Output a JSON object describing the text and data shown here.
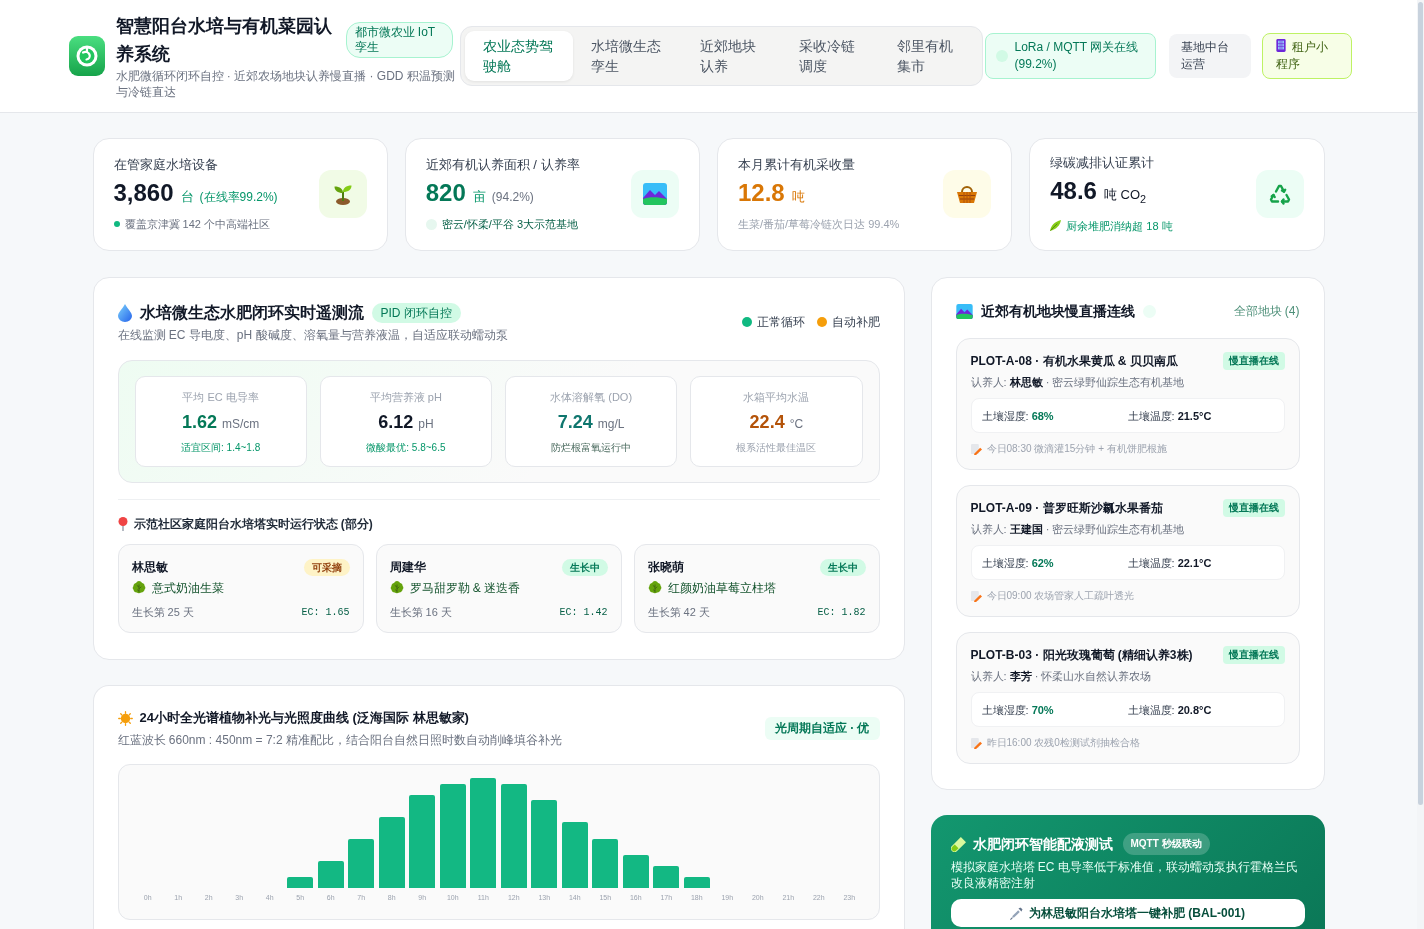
{
  "header": {
    "title": "智慧阳台水培与有机菜园认养系统",
    "badge": "都市微农业 IoT 孪生",
    "subtitle": "水肥微循环闭环自控 · 近郊农场地块认养慢直播 · GDD 积温预测与冷链直达",
    "tabs": [
      {
        "label": "农业态势驾驶舱",
        "selected": true
      },
      {
        "label": "水培微生态孪生",
        "selected": false
      },
      {
        "label": "近郊地块认养",
        "selected": false
      },
      {
        "label": "采收冷链调度",
        "selected": false
      },
      {
        "label": "邻里有机集市",
        "selected": false
      }
    ],
    "gateway": "LoRa / MQTT 网关在线 (99.2%)",
    "actions": [
      {
        "label": "基地中台运营",
        "kind": "plain"
      },
      {
        "label": "租户小程序",
        "kind": "app"
      }
    ]
  },
  "kpis": [
    {
      "label": "在管家庭水培设备",
      "value": "3,860",
      "unit": "台",
      "extra": "(在线率99.2%)",
      "note": "覆盖京津冀 142 个中高端社区",
      "color": "#111827"
    },
    {
      "label": "近郊有机认养面积 / 认养率",
      "value": "820",
      "unit": "亩",
      "extra": "(94.2%)",
      "note": "密云/怀柔/平谷 3大示范基地",
      "color": "#047857"
    },
    {
      "label": "本月累计有机采收量",
      "value": "12.8",
      "unit": "吨",
      "note": "生菜/番茄/草莓冷链次日达 99.4%",
      "color": "#d97706"
    },
    {
      "label": "绿碳减排认证累计",
      "value": "48.6",
      "unit": "吨 CO$_{2}$",
      "note": "厨余堆肥消纳超 18 吨",
      "color": "#111827"
    }
  ],
  "telemetry": {
    "title": "水培微生态水肥闭环实时遥测流",
    "badge": "PID 闭环自控",
    "subtitle": "在线监测 EC 导电度、pH 酸碱度、溶氧量与营养液温，自适应联动蠕动泵",
    "legend": [
      {
        "label": "正常循环",
        "color": "#10b981"
      },
      {
        "label": "自动补肥",
        "color": "#f59e0b"
      }
    ],
    "metrics": [
      {
        "label": "平均 EC 电导率",
        "value": "1.62",
        "unit": "mS/cm",
        "note": "适宜区间: 1.4~1.8",
        "color": "#047857"
      },
      {
        "label": "平均营养液 pH",
        "value": "6.12",
        "unit": "pH",
        "note": "微酸最优: 5.8~6.5",
        "color": "#111827"
      },
      {
        "label": "水体溶解氧 (DO)",
        "value": "7.24",
        "unit": "mg/L",
        "note": "防烂根富氧运行中",
        "color": "#0f766e"
      },
      {
        "label": "水箱平均水温",
        "value": "22.4",
        "unit": "°C",
        "note": "根系活性最佳温区",
        "color": "#b45309"
      }
    ],
    "towers_title": "示范社区家庭阳台水培塔实时运行状态 (部分)",
    "towers": [
      {
        "owner": "林思敏",
        "status": "可采摘",
        "ready": true,
        "plant": "意式奶油生菜",
        "days": "生长第 25 天",
        "ec": "EC: 1.65"
      },
      {
        "owner": "周建华",
        "status": "生长中",
        "ready": false,
        "plant": "罗马甜罗勒 & 迷迭香",
        "days": "生长第 16 天",
        "ec": "EC: 1.42"
      },
      {
        "owner": "张晓萌",
        "status": "生长中",
        "ready": false,
        "plant": "红颜奶油草莓立柱塔",
        "days": "生长第 42 天",
        "ec": "EC: 1.82"
      }
    ]
  },
  "lighting": {
    "title": "24小时全光谱植物补光与光照度曲线 (泛海国际 林思敏家)",
    "subtitle": "红蓝波长 660nm : 450nm = 7:2 精准配比，结合阳台自然日照时数自动削峰填谷补光",
    "badge": "光周期自适应 · 优",
    "hour_labels": [
      "0h",
      "1h",
      "2h",
      "3h",
      "4h",
      "5h",
      "6h",
      "7h",
      "8h",
      "9h",
      "10h",
      "11h",
      "12h",
      "13h",
      "14h",
      "15h",
      "16h",
      "17h",
      "18h",
      "19h",
      "20h",
      "21h",
      "22h",
      "23h"
    ]
  },
  "plots": {
    "title": "近郊有机地块慢直播连线",
    "link": "全部地块 (4)",
    "items": [
      {
        "title": "PLOT-A-08 · 有机水果黄瓜 & 贝贝南瓜",
        "status": "慢直播在线",
        "adopter": "认养人: **林思敏** · 密云绿野仙踪生态有机基地",
        "humidity": "土壤湿度: **68%**",
        "temperature": "土壤温度: **21.5°C**",
        "log": "今日08:30 微滴灌15分钟 + 有机饼肥根施"
      },
      {
        "title": "PLOT-A-09 · 普罗旺斯沙瓤水果番茄",
        "status": "慢直播在线",
        "adopter": "认养人: **王建国** · 密云绿野仙踪生态有机基地",
        "humidity": "土壤湿度: **62%**",
        "temperature": "土壤温度: **22.1°C**",
        "log": "今日09:00 农场管家人工疏叶透光"
      },
      {
        "title": "PLOT-B-03 · 阳光玫瑰葡萄 (精细认养3株)",
        "status": "慢直播在线",
        "adopter": "认养人: **李芳** · 怀柔山水自然认养农场",
        "humidity": "土壤湿度: **70%**",
        "temperature": "土壤温度: **20.8°C**",
        "log": "昨日16:00 农残0检测试剂抽检合格"
      }
    ]
  },
  "dosing": {
    "title": "水肥闭环智能配液测试",
    "badge": "MQTT 秒级联动",
    "description": "模拟家庭水培塔 EC 电导率低于标准值，联动蠕动泵执行霍格兰氏改良液精密注射",
    "button": "为林思敏阳台水培塔一键补肥 (BAL-001)"
  }
}
